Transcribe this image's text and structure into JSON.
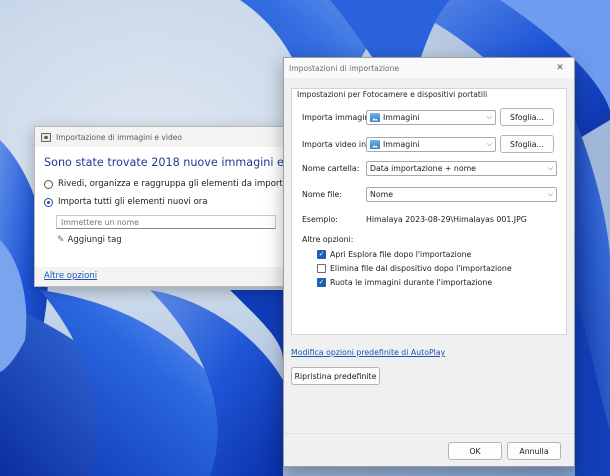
{
  "back_dialog": {
    "title": "Importazione di immagini e video",
    "headline": "Sono state trovate 2018 nuove immagini e video",
    "option_review": "Rivedi, organizza e raggruppa gli elementi da importare",
    "option_import_all": "Importa tutti gli elementi nuovi ora",
    "name_placeholder": "Immettere un nome",
    "add_tag": "Aggiungi tag",
    "more_options": "Altre opzioni",
    "icon": "camera-icon"
  },
  "settings_dialog": {
    "title": "Impostazioni di importazione",
    "group_title": "Impostazioni per Fotocamere e dispositivi portatili",
    "import_images_label": "Importa immagini in:",
    "import_images_value": "Immagini",
    "import_video_label": "Importa video in:",
    "import_video_value": "Immagini",
    "browse_label": "Sfoglia...",
    "folder_name_label": "Nome cartella:",
    "folder_name_value": "Data importazione + nome",
    "file_name_label": "Nome file:",
    "file_name_value": "Nome",
    "example_label": "Esempio:",
    "example_value": "Himalaya 2023-08-29\\Himalayas 001.JPG",
    "other_options_label": "Altre opzioni:",
    "checkboxes": [
      {
        "label": "Apri Esplora file dopo l'importazione",
        "checked": true
      },
      {
        "label": "Elimina file dal dispositivo dopo l'importazione",
        "checked": false
      },
      {
        "label": "Ruota le immagini durante l'importazione",
        "checked": true
      }
    ],
    "autoplay_link": "Modifica opzioni predefinite di AutoPlay",
    "restore_defaults": "Ripristina predefinite",
    "ok": "OK",
    "cancel": "Annulla",
    "close_icon": "close-icon",
    "folder_icon": "pictures-folder-icon"
  },
  "colors": {
    "accent": "#1a5fb4",
    "headline": "#1f3a93",
    "link": "#1a55b5",
    "wallpaper_blue": "#1f56d6"
  }
}
